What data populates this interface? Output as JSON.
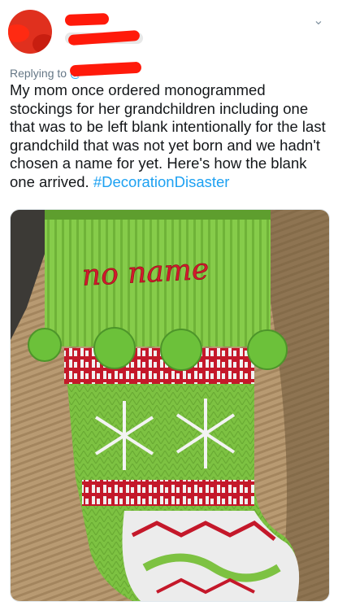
{
  "tweet": {
    "replying_prefix": "Replying to",
    "replying_at": "@",
    "text": "My mom once ordered monogrammed stockings for her grandchildren including one that was to be left blank intentionally for the last grandchild that was not yet born and we hadn't chosen a name for yet.  Here's how the blank one arrived. ",
    "hashtag": "#DecorationDisaster"
  },
  "photo": {
    "embroidery": "no name"
  },
  "icons": {
    "menu": "chevron-down-icon"
  },
  "colors": {
    "link": "#1da1f2",
    "text": "#14171a",
    "muted": "#657786",
    "stocking_green": "#7dc242",
    "stocking_red": "#c4182a"
  }
}
